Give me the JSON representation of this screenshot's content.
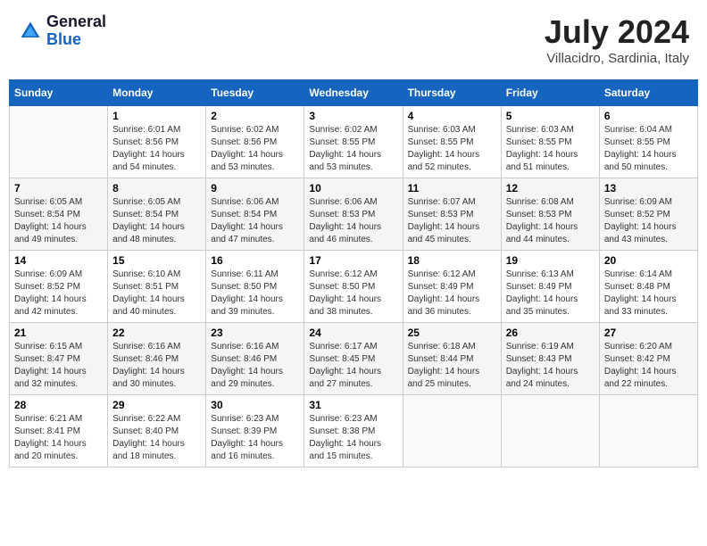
{
  "header": {
    "logo_general": "General",
    "logo_blue": "Blue",
    "month_year": "July 2024",
    "location": "Villacidro, Sardinia, Italy"
  },
  "calendar": {
    "days_of_week": [
      "Sunday",
      "Monday",
      "Tuesday",
      "Wednesday",
      "Thursday",
      "Friday",
      "Saturday"
    ],
    "weeks": [
      [
        {
          "day": "",
          "info": ""
        },
        {
          "day": "1",
          "info": "Sunrise: 6:01 AM\nSunset: 8:56 PM\nDaylight: 14 hours\nand 54 minutes."
        },
        {
          "day": "2",
          "info": "Sunrise: 6:02 AM\nSunset: 8:56 PM\nDaylight: 14 hours\nand 53 minutes."
        },
        {
          "day": "3",
          "info": "Sunrise: 6:02 AM\nSunset: 8:55 PM\nDaylight: 14 hours\nand 53 minutes."
        },
        {
          "day": "4",
          "info": "Sunrise: 6:03 AM\nSunset: 8:55 PM\nDaylight: 14 hours\nand 52 minutes."
        },
        {
          "day": "5",
          "info": "Sunrise: 6:03 AM\nSunset: 8:55 PM\nDaylight: 14 hours\nand 51 minutes."
        },
        {
          "day": "6",
          "info": "Sunrise: 6:04 AM\nSunset: 8:55 PM\nDaylight: 14 hours\nand 50 minutes."
        }
      ],
      [
        {
          "day": "7",
          "info": "Sunrise: 6:05 AM\nSunset: 8:54 PM\nDaylight: 14 hours\nand 49 minutes."
        },
        {
          "day": "8",
          "info": "Sunrise: 6:05 AM\nSunset: 8:54 PM\nDaylight: 14 hours\nand 48 minutes."
        },
        {
          "day": "9",
          "info": "Sunrise: 6:06 AM\nSunset: 8:54 PM\nDaylight: 14 hours\nand 47 minutes."
        },
        {
          "day": "10",
          "info": "Sunrise: 6:06 AM\nSunset: 8:53 PM\nDaylight: 14 hours\nand 46 minutes."
        },
        {
          "day": "11",
          "info": "Sunrise: 6:07 AM\nSunset: 8:53 PM\nDaylight: 14 hours\nand 45 minutes."
        },
        {
          "day": "12",
          "info": "Sunrise: 6:08 AM\nSunset: 8:53 PM\nDaylight: 14 hours\nand 44 minutes."
        },
        {
          "day": "13",
          "info": "Sunrise: 6:09 AM\nSunset: 8:52 PM\nDaylight: 14 hours\nand 43 minutes."
        }
      ],
      [
        {
          "day": "14",
          "info": "Sunrise: 6:09 AM\nSunset: 8:52 PM\nDaylight: 14 hours\nand 42 minutes."
        },
        {
          "day": "15",
          "info": "Sunrise: 6:10 AM\nSunset: 8:51 PM\nDaylight: 14 hours\nand 40 minutes."
        },
        {
          "day": "16",
          "info": "Sunrise: 6:11 AM\nSunset: 8:50 PM\nDaylight: 14 hours\nand 39 minutes."
        },
        {
          "day": "17",
          "info": "Sunrise: 6:12 AM\nSunset: 8:50 PM\nDaylight: 14 hours\nand 38 minutes."
        },
        {
          "day": "18",
          "info": "Sunrise: 6:12 AM\nSunset: 8:49 PM\nDaylight: 14 hours\nand 36 minutes."
        },
        {
          "day": "19",
          "info": "Sunrise: 6:13 AM\nSunset: 8:49 PM\nDaylight: 14 hours\nand 35 minutes."
        },
        {
          "day": "20",
          "info": "Sunrise: 6:14 AM\nSunset: 8:48 PM\nDaylight: 14 hours\nand 33 minutes."
        }
      ],
      [
        {
          "day": "21",
          "info": "Sunrise: 6:15 AM\nSunset: 8:47 PM\nDaylight: 14 hours\nand 32 minutes."
        },
        {
          "day": "22",
          "info": "Sunrise: 6:16 AM\nSunset: 8:46 PM\nDaylight: 14 hours\nand 30 minutes."
        },
        {
          "day": "23",
          "info": "Sunrise: 6:16 AM\nSunset: 8:46 PM\nDaylight: 14 hours\nand 29 minutes."
        },
        {
          "day": "24",
          "info": "Sunrise: 6:17 AM\nSunset: 8:45 PM\nDaylight: 14 hours\nand 27 minutes."
        },
        {
          "day": "25",
          "info": "Sunrise: 6:18 AM\nSunset: 8:44 PM\nDaylight: 14 hours\nand 25 minutes."
        },
        {
          "day": "26",
          "info": "Sunrise: 6:19 AM\nSunset: 8:43 PM\nDaylight: 14 hours\nand 24 minutes."
        },
        {
          "day": "27",
          "info": "Sunrise: 6:20 AM\nSunset: 8:42 PM\nDaylight: 14 hours\nand 22 minutes."
        }
      ],
      [
        {
          "day": "28",
          "info": "Sunrise: 6:21 AM\nSunset: 8:41 PM\nDaylight: 14 hours\nand 20 minutes."
        },
        {
          "day": "29",
          "info": "Sunrise: 6:22 AM\nSunset: 8:40 PM\nDaylight: 14 hours\nand 18 minutes."
        },
        {
          "day": "30",
          "info": "Sunrise: 6:23 AM\nSunset: 8:39 PM\nDaylight: 14 hours\nand 16 minutes."
        },
        {
          "day": "31",
          "info": "Sunrise: 6:23 AM\nSunset: 8:38 PM\nDaylight: 14 hours\nand 15 minutes."
        },
        {
          "day": "",
          "info": ""
        },
        {
          "day": "",
          "info": ""
        },
        {
          "day": "",
          "info": ""
        }
      ]
    ]
  }
}
